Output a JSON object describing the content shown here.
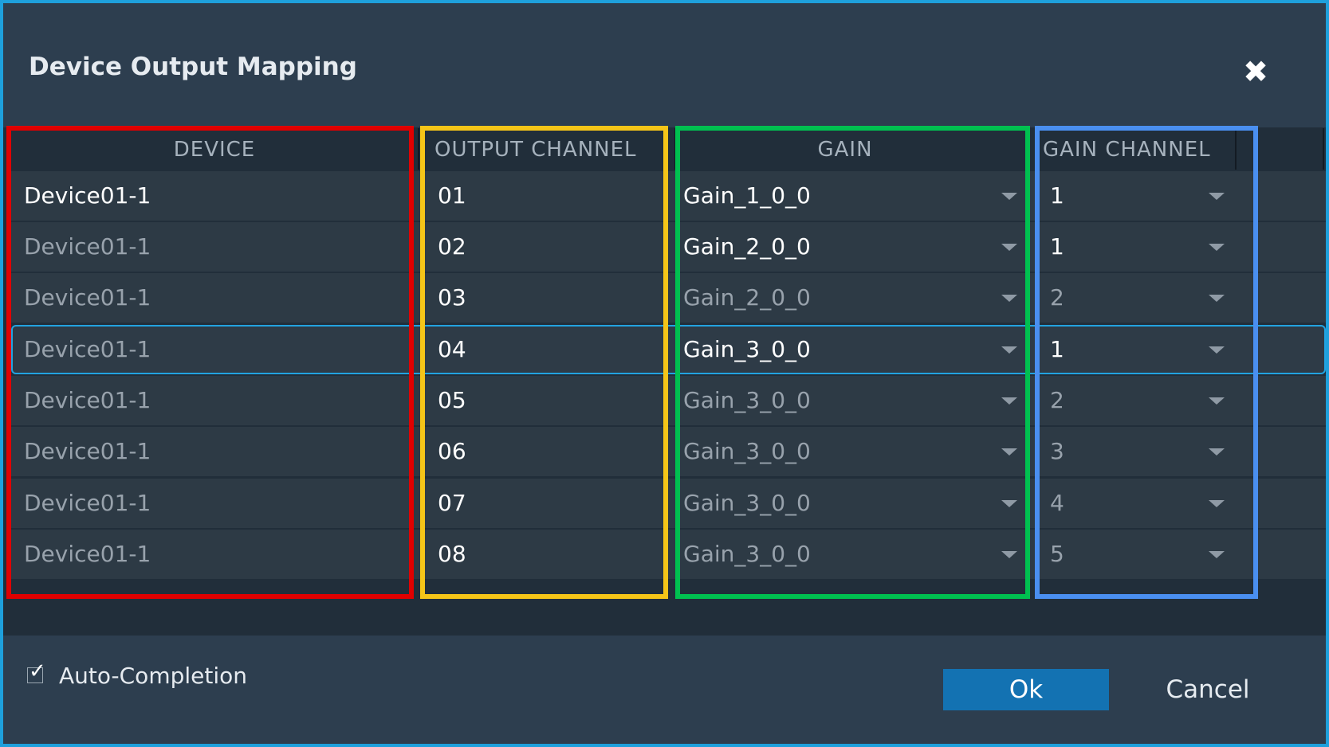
{
  "dialog": {
    "title": "Device Output Mapping",
    "close_icon": "close-icon",
    "accent_color": "#1ea0dc"
  },
  "table": {
    "columns": [
      "DEVICE",
      "OUTPUT CHANNEL",
      "GAIN",
      "GAIN CHANNEL"
    ],
    "rows": [
      {
        "device": "Device01-1",
        "output_channel": "01",
        "gain": "Gain_1_0_0",
        "gain_channel": "1"
      },
      {
        "device": "Device01-1",
        "output_channel": "02",
        "gain": "Gain_2_0_0",
        "gain_channel": "1"
      },
      {
        "device": "Device01-1",
        "output_channel": "03",
        "gain": "Gain_2_0_0",
        "gain_channel": "2"
      },
      {
        "device": "Device01-1",
        "output_channel": "04",
        "gain": "Gain_3_0_0",
        "gain_channel": "1"
      },
      {
        "device": "Device01-1",
        "output_channel": "05",
        "gain": "Gain_3_0_0",
        "gain_channel": "2"
      },
      {
        "device": "Device01-1",
        "output_channel": "06",
        "gain": "Gain_3_0_0",
        "gain_channel": "3"
      },
      {
        "device": "Device01-1",
        "output_channel": "07",
        "gain": "Gain_3_0_0",
        "gain_channel": "4"
      },
      {
        "device": "Device01-1",
        "output_channel": "08",
        "gain": "Gain_3_0_0",
        "gain_channel": "5"
      }
    ],
    "selected_row": "04"
  },
  "highlights": [
    {
      "column": "DEVICE",
      "color": "#e00000"
    },
    {
      "column": "OUTPUT CHANNEL",
      "color": "#f5c518"
    },
    {
      "column": "GAIN",
      "color": "#00c050"
    },
    {
      "column": "GAIN CHANNEL",
      "color": "#4a8ff0"
    }
  ],
  "footer": {
    "auto_completion_label": "Auto-Completion",
    "auto_completion_checked": true,
    "ok_label": "Ok",
    "cancel_label": "Cancel",
    "ok_color": "#1372b2"
  }
}
